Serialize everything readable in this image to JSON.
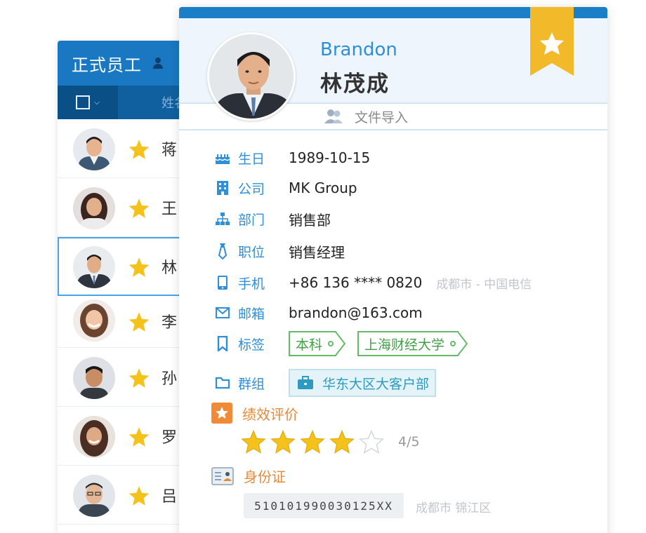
{
  "list": {
    "title": "正式员工",
    "column_name": "姓名",
    "rows": [
      {
        "surname": "蒋",
        "starred": true
      },
      {
        "surname": "王",
        "starred": true
      },
      {
        "surname": "林",
        "starred": true,
        "selected": true
      },
      {
        "surname": "李",
        "starred": true
      },
      {
        "surname": "孙",
        "starred": true
      },
      {
        "surname": "罗",
        "starred": true
      },
      {
        "surname": "吕",
        "starred": true
      }
    ]
  },
  "profile": {
    "name_en": "Brandon",
    "name_cn": "林茂成",
    "import_label": "文件导入",
    "fields": {
      "birthday": {
        "label": "生日",
        "value": "1989-10-15"
      },
      "company": {
        "label": "公司",
        "value": "MK Group"
      },
      "department": {
        "label": "部门",
        "value": "销售部"
      },
      "position": {
        "label": "职位",
        "value": "销售经理"
      },
      "phone": {
        "label": "手机",
        "value": "+86 136 **** 0820",
        "note": "成都市 - 中国电信"
      },
      "email": {
        "label": "邮箱",
        "value": "brandon@163.com"
      },
      "tags": {
        "label": "标签",
        "items": [
          "本科",
          "上海财经大学"
        ]
      },
      "group": {
        "label": "群组",
        "value": "华东大区大客户部"
      }
    },
    "performance": {
      "label": "绩效评价",
      "rating": 4,
      "max": 5,
      "score_text": "4/5"
    },
    "id_card": {
      "label": "身份证",
      "number": "510101990030125XX",
      "note": "成都市 锦江区"
    }
  },
  "colors": {
    "primary": "#1a7fc7",
    "label_blue": "#2f8fd8",
    "star_gold": "#f5c21b",
    "tag_green": "#43a047",
    "section_orange": "#e38a3b",
    "group_teal": "#2e9ac2"
  },
  "icons": {
    "birthday": "cake-icon",
    "company": "building-icon",
    "department": "org-chart-icon",
    "position": "tie-icon",
    "phone": "phone-icon",
    "email": "mail-icon",
    "tags": "bookmark-icon",
    "group": "folder-icon"
  }
}
